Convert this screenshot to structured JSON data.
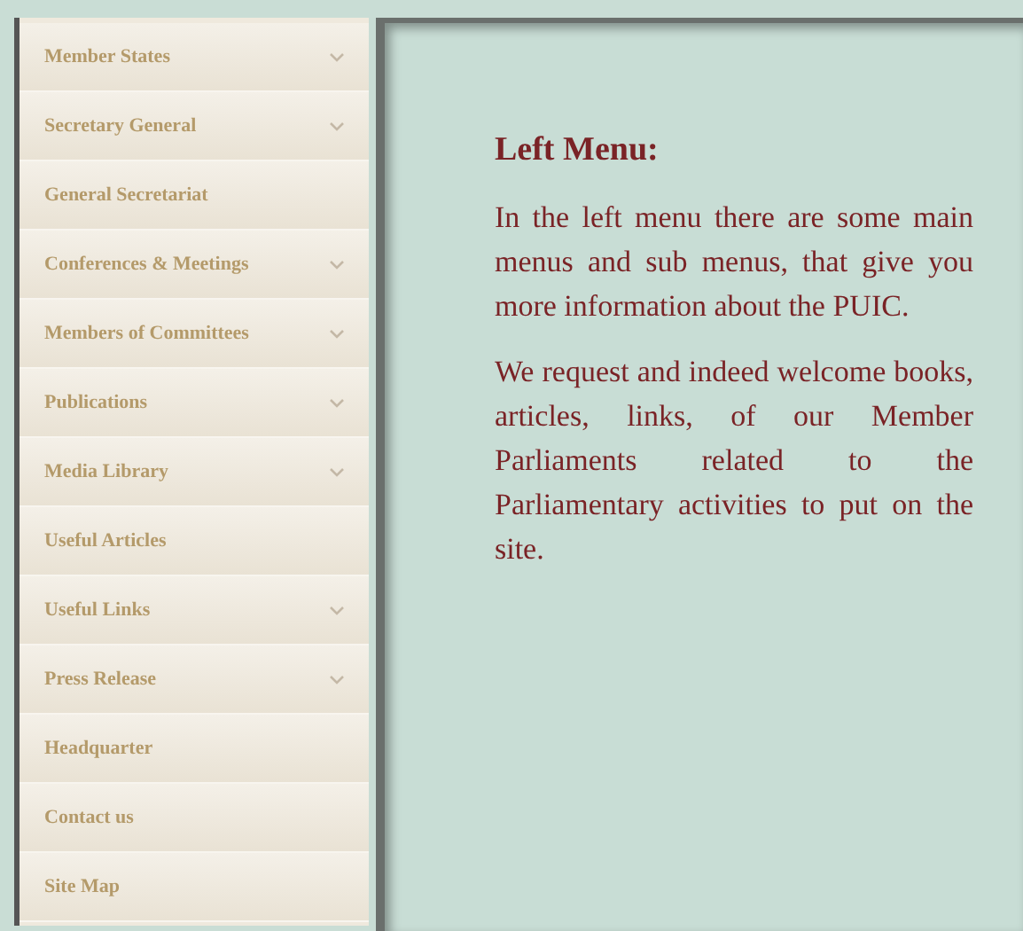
{
  "sidebar": {
    "items": [
      {
        "label": "Member States",
        "expandable": true
      },
      {
        "label": "Secretary General",
        "expandable": true
      },
      {
        "label": "General Secretariat",
        "expandable": false
      },
      {
        "label": "Conferences & Meetings",
        "expandable": true
      },
      {
        "label": "Members of Committees",
        "expandable": true
      },
      {
        "label": "Publications",
        "expandable": true
      },
      {
        "label": "Media Library",
        "expandable": true
      },
      {
        "label": "Useful Articles",
        "expandable": false
      },
      {
        "label": "Useful Links",
        "expandable": true
      },
      {
        "label": "Press Release",
        "expandable": true
      },
      {
        "label": "Headquarter",
        "expandable": false
      },
      {
        "label": "Contact us",
        "expandable": false
      },
      {
        "label": "Site Map",
        "expandable": false
      }
    ]
  },
  "content": {
    "heading": "Left Menu:",
    "paragraphs": [
      "In the left menu there are some main menus and sub menus, that give you more information about the PUIC.",
      "We request and indeed welcome books, articles, links, of our Member Parliaments related to the Parliamentary activities to put on the site."
    ]
  }
}
